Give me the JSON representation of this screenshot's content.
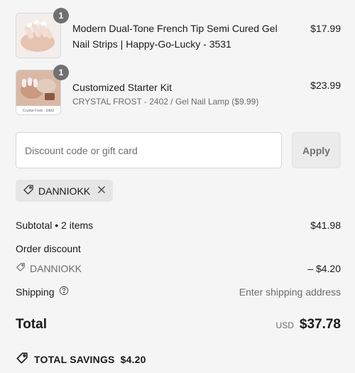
{
  "items": [
    {
      "qty": "1",
      "title_line1": "Modern Dual-Tone French Tip Semi Cured Gel",
      "title_line2": "Nail Strips | Happy-Go-Lucky - 3531",
      "price": "$17.99"
    },
    {
      "qty": "1",
      "title": "Customized Starter Kit",
      "variant": "CRYSTAL FROST - 2402 / Gel Nail Lamp ($9.99)",
      "price": "$23.99",
      "thumb_caption": "Crystal Frost - 2402"
    }
  ],
  "discount": {
    "placeholder": "Discount code or gift card",
    "apply_label": "Apply",
    "applied_code": "DANNIOKK"
  },
  "summary": {
    "subtotal_label": "Subtotal • 2 items",
    "subtotal_value": "$41.98",
    "order_discount_label": "Order discount",
    "discount_code": "DANNIOKK",
    "discount_value": "– $4.20",
    "shipping_label": "Shipping",
    "shipping_value": "Enter shipping address",
    "total_label": "Total",
    "currency": "USD",
    "total_value": "$37.78",
    "savings_label": "TOTAL SAVINGS",
    "savings_value": "$4.20"
  },
  "icons": {
    "tag": "tag-icon",
    "remove": "close-icon",
    "help": "help-circle-icon",
    "savings": "savings-tag-icon"
  },
  "colors": {
    "background": "#f5f5f5",
    "quantity_badge": "#707070",
    "muted_text": "#6b6b6b"
  }
}
